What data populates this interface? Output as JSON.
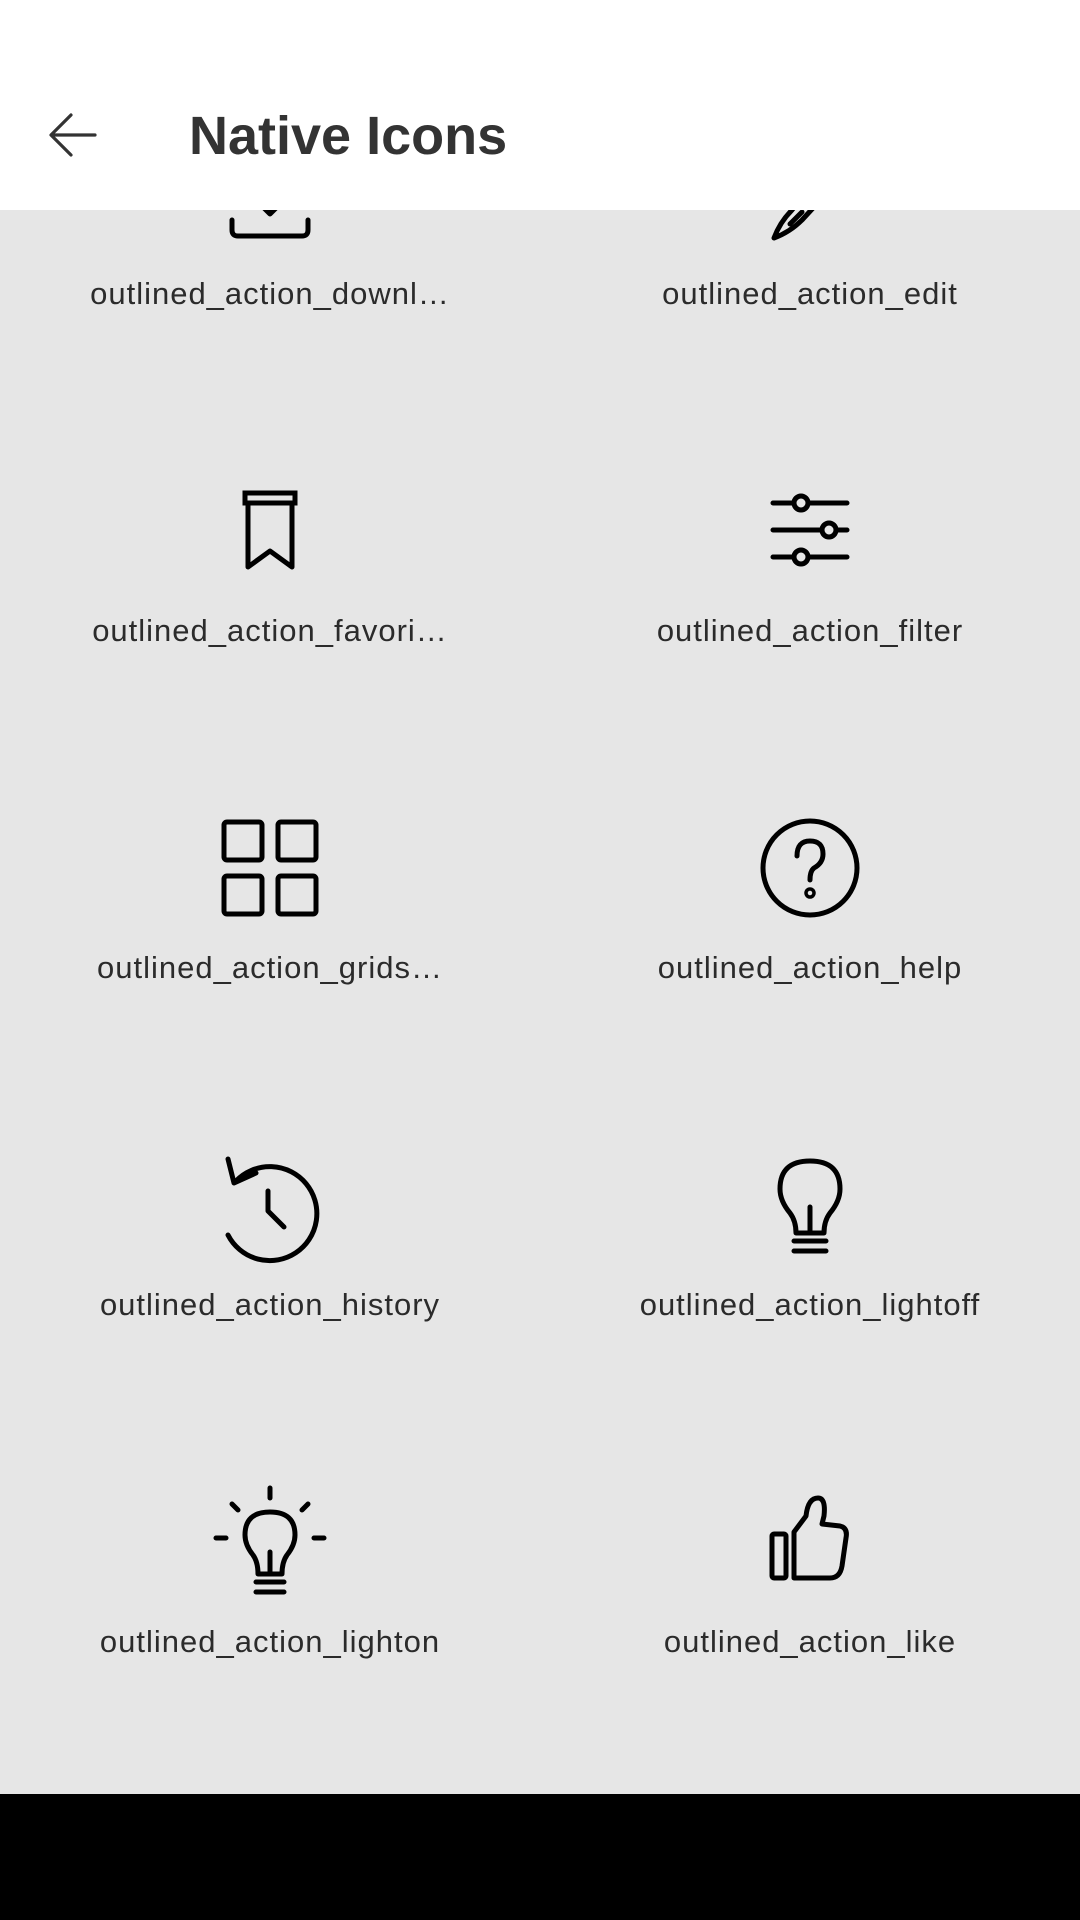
{
  "header": {
    "title": "Native Icons",
    "back_icon": "arrow-left-icon"
  },
  "icons": [
    {
      "label": "outlined_action_downl…",
      "icon": "download-icon"
    },
    {
      "label": "outlined_action_edit",
      "icon": "edit-pencil-icon"
    },
    {
      "label": "outlined_action_favori…",
      "icon": "bookmark-icon"
    },
    {
      "label": "outlined_action_filter",
      "icon": "filter-sliders-icon"
    },
    {
      "label": "outlined_action_grids…",
      "icon": "grid-icon"
    },
    {
      "label": "outlined_action_help",
      "icon": "help-circle-icon"
    },
    {
      "label": "outlined_action_history",
      "icon": "history-icon"
    },
    {
      "label": "outlined_action_lightoff",
      "icon": "lightbulb-off-icon"
    },
    {
      "label": "outlined_action_lighton",
      "icon": "lightbulb-on-icon"
    },
    {
      "label": "outlined_action_like",
      "icon": "thumbs-up-icon"
    }
  ],
  "colors": {
    "appbar_background": "#ffffff",
    "content_background": "#e6e6e6",
    "title_text": "#333333",
    "label_text": "#2b2b2b",
    "icon_stroke": "#000000",
    "navbar_background": "#000000"
  }
}
